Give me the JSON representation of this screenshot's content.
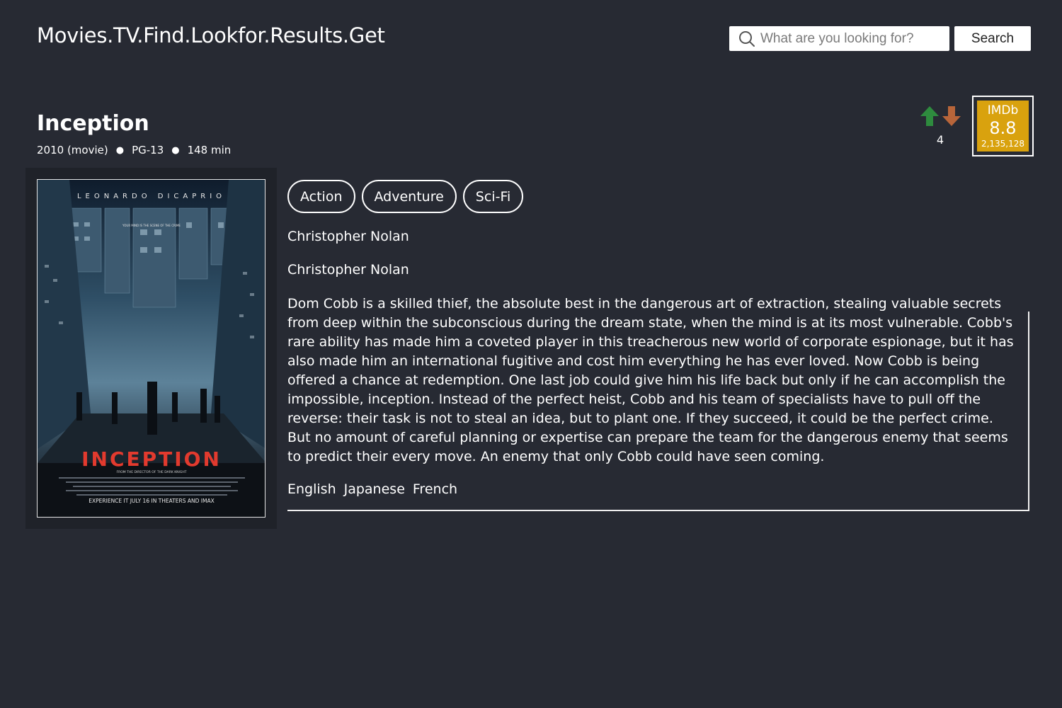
{
  "header": {
    "site_title": "Movies.TV.Find.Lookfor.Results.Get",
    "search_placeholder": "What are you looking for?",
    "search_button": "Search"
  },
  "movie": {
    "title": "Inception",
    "meta": [
      "2010 (movie)",
      "PG-13",
      "148 min"
    ],
    "genres": [
      "Action",
      "Adventure",
      "Sci-Fi"
    ],
    "director": "Christopher Nolan",
    "writer": "Christopher Nolan",
    "plot": "Dom Cobb is a skilled thief, the absolute best in the dangerous art of extraction, stealing valuable secrets from deep within the subconscious during the dream state, when the mind is at its most vulnerable. Cobb's rare ability has made him a coveted player in this treacherous new world of corporate espionage, but it has also made him an international fugitive and cost him everything he has ever loved. Now Cobb is being offered a chance at redemption. One last job could give him his life back but only if he can accomplish the impossible, inception. Instead of the perfect heist, Cobb and his team of specialists have to pull off the reverse: their task is not to steal an idea, but to plant one. If they succeed, it could be the perfect crime. But no amount of careful planning or expertise can prepare the team for the dangerous enemy that seems to predict their every move. An enemy that only Cobb could have seen coming.",
    "languages": [
      "English",
      "Japanese",
      "French"
    ]
  },
  "votes": {
    "count": "4",
    "up_icon": "arrow-up-icon",
    "down_icon": "arrow-down-icon",
    "up_color": "#2e8b3e",
    "down_color": "#b8653a"
  },
  "imdb": {
    "label": "IMDb",
    "score": "8.8",
    "votes": "2,135,128",
    "color": "#d9a20e"
  },
  "poster": {
    "top_text": "LEONARDO DICAPRIO",
    "tagline": "YOUR MIND IS THE SCENE OF THE CRIME",
    "title_text": "INCEPTION",
    "subtitle": "FROM THE DIRECTOR OF THE DARK KNIGHT",
    "bottom_text": "EXPERIENCE IT JULY 16 IN THEATERS AND IMAX"
  },
  "colors": {
    "background": "#272a33",
    "poster_frame": "#1f2229",
    "text": "#ffffff"
  }
}
